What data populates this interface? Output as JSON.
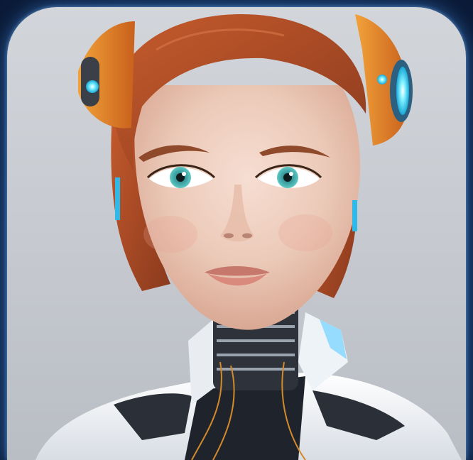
{
  "image": {
    "subject": "android-woman-portrait",
    "colors": {
      "page_background": "#0f2548",
      "glow": "#4fa3ff",
      "studio_backdrop": "#c9cdd3",
      "hair": "#b4512a",
      "skin": "#efcdbd",
      "eyes": "#3fb6b2",
      "headphone_orange": "#e07a22",
      "headphone_glow": "#3fe0ff",
      "armor_white": "#eef1f5",
      "armor_dark": "#2a2f38"
    }
  }
}
